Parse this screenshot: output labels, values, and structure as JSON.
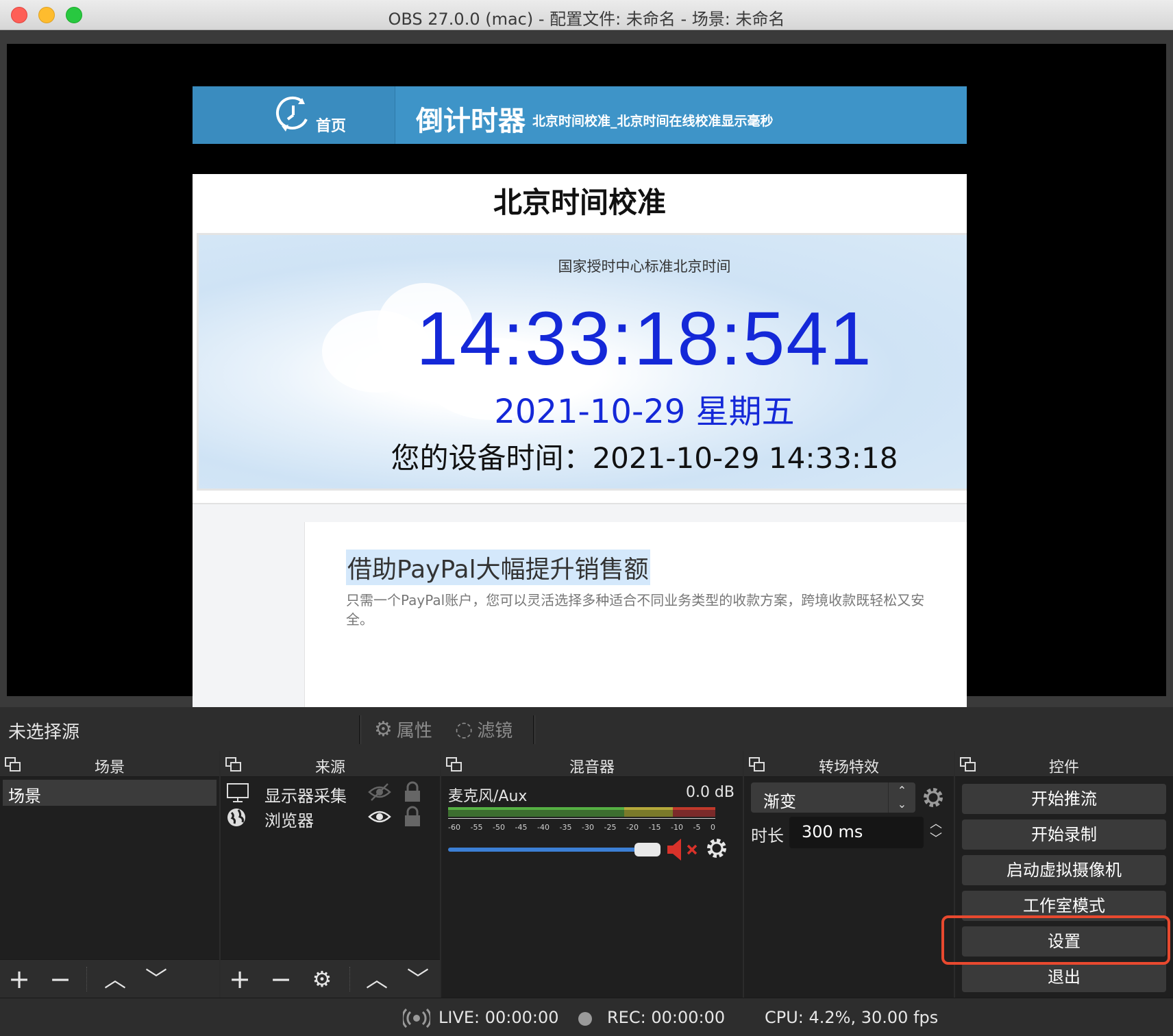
{
  "window": {
    "title": "OBS 27.0.0 (mac) - 配置文件: 未命名 - 场景: 未命名"
  },
  "preview": {
    "banner_home": "首页",
    "banner_title": "倒计时器",
    "banner_subtitle": "北京时间校准_北京时间在线校准显示毫秒",
    "page_heading": "北京时间校准",
    "clock_caption": "国家授时中心标准北京时间",
    "clock_time": "14:33:18:541",
    "clock_date": "2021-10-29 星期五",
    "device_time": "您的设备时间：2021-10-29 14:33:18",
    "ad_title": "借助PayPal大幅提升销售额",
    "ad_text": "只需一个PayPal账户，您可以灵活选择多种适合不同业务类型的收款方案，跨境收款既轻松又安全。"
  },
  "source_toolbar": {
    "no_source": "未选择源",
    "properties": "属性",
    "filters": "滤镜"
  },
  "docks": {
    "scenes": {
      "title": "场景",
      "items": [
        "场景"
      ]
    },
    "sources": {
      "title": "来源",
      "items": [
        {
          "name": "显示器采集",
          "icon": "monitor-icon",
          "visible": false
        },
        {
          "name": "浏览器",
          "icon": "globe-icon",
          "visible": true
        }
      ]
    },
    "mixer": {
      "title": "混音器",
      "channel": "麦克风/Aux",
      "level": "0.0 dB",
      "ticks": [
        "-60",
        "-55",
        "-50",
        "-45",
        "-40",
        "-35",
        "-30",
        "-25",
        "-20",
        "-15",
        "-10",
        "-5",
        "0"
      ],
      "volume": 0.92,
      "muted": true
    },
    "transitions": {
      "title": "转场特效",
      "selected": "渐变",
      "duration_label": "时长",
      "duration_value": "300 ms"
    },
    "controls": {
      "title": "控件",
      "buttons": [
        "开始推流",
        "开始录制",
        "启动虚拟摄像机",
        "工作室模式",
        "设置",
        "退出"
      ],
      "highlighted": "设置"
    }
  },
  "status": {
    "live": "LIVE: 00:00:00",
    "rec": "REC: 00:00:00",
    "cpu": "CPU: 4.2%, 30.00 fps"
  },
  "colors": {
    "accent_blue": "#3e94c8",
    "clock_blue": "#1428d8",
    "highlight": "#e8492f"
  }
}
